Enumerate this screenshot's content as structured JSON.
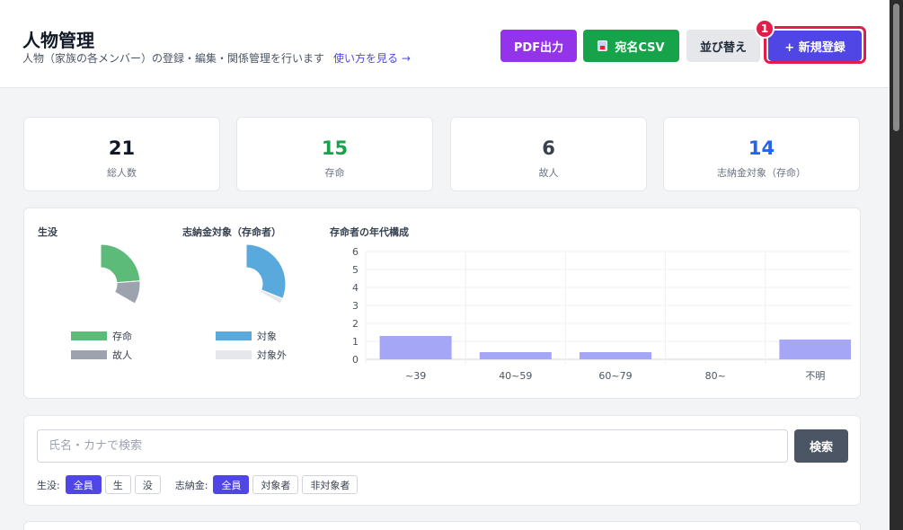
{
  "header": {
    "title": "人物管理",
    "subtitle": "人物（家族の各メンバー）の登録・編集・関係管理を行います",
    "help_link": "使い方を見る →",
    "buttons": {
      "pdf": "PDF出力",
      "csv": "宛名CSV",
      "sort": "並び替え",
      "new": "+ 新規登録"
    },
    "step_marker": "1"
  },
  "stats": [
    {
      "value": "21",
      "label": "総人数"
    },
    {
      "value": "15",
      "label": "存命"
    },
    {
      "value": "6",
      "label": "故人"
    },
    {
      "value": "14",
      "label": "志納金対象（存命）"
    }
  ],
  "charts": {
    "life": {
      "title": "生没",
      "legend": [
        {
          "label": "存命",
          "color": "#5dbb7a"
        },
        {
          "label": "故人",
          "color": "#9ca3af"
        }
      ]
    },
    "donation": {
      "title": "志納金対象（存命者）",
      "legend": [
        {
          "label": "対象",
          "color": "#5aa9dc"
        },
        {
          "label": "対象外",
          "color": "#e5e7eb"
        }
      ]
    },
    "age": {
      "title": "存命者の年代構成"
    }
  },
  "chart_data": [
    {
      "type": "pie",
      "title": "生没",
      "labels": [
        "存命",
        "故人"
      ],
      "values": [
        15,
        6
      ],
      "colors": [
        "#5dbb7a",
        "#9ca3af"
      ]
    },
    {
      "type": "pie",
      "title": "志納金対象（存命者）",
      "labels": [
        "対象",
        "対象外"
      ],
      "values": [
        14,
        1
      ],
      "colors": [
        "#5aa9dc",
        "#e5e7eb"
      ]
    },
    {
      "type": "bar",
      "title": "存命者の年代構成",
      "categories": [
        "~39",
        "40~59",
        "60~79",
        "80~",
        "不明"
      ],
      "values": [
        1.3,
        0.4,
        0.4,
        0,
        1.1
      ],
      "ylim": [
        0,
        6
      ],
      "yticks": [
        "0",
        "1",
        "2",
        "3",
        "4",
        "5",
        "6"
      ],
      "color": "#a5a6f6",
      "grid": true
    }
  ],
  "search": {
    "placeholder": "氏名・カナで検索",
    "value": "",
    "button": "検索"
  },
  "filters": {
    "life_label": "生没:",
    "life_options": [
      "全員",
      "生",
      "没"
    ],
    "life_selected": 0,
    "donation_label": "志納金:",
    "donation_options": [
      "全員",
      "対象者",
      "非対象者"
    ],
    "donation_selected": 0
  }
}
